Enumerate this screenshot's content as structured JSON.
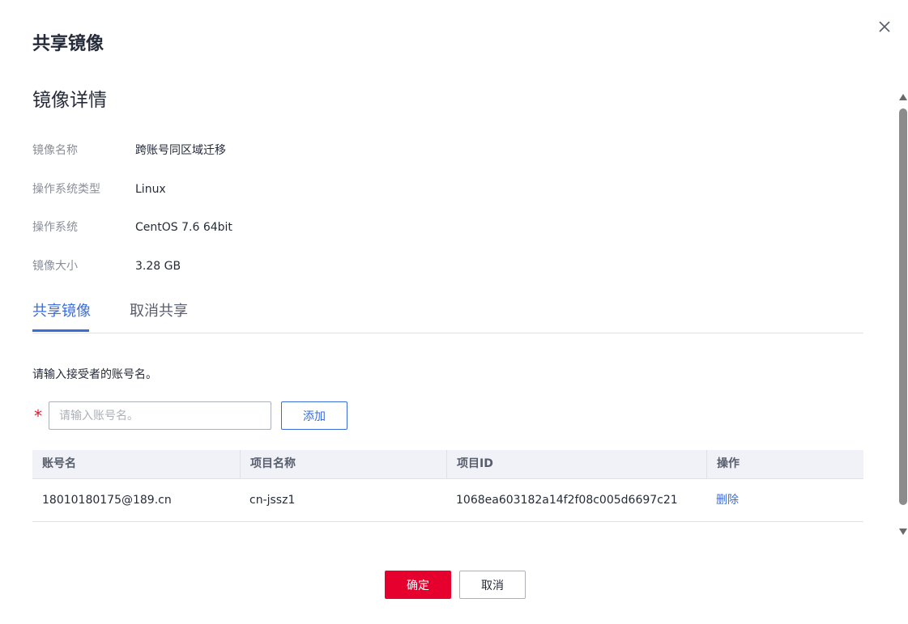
{
  "dialog": {
    "title": "共享镜像",
    "close_icon": "close-icon"
  },
  "details": {
    "section_title": "镜像详情",
    "rows": [
      {
        "label": "镜像名称",
        "value": "跨账号同区域迁移"
      },
      {
        "label": "操作系统类型",
        "value": "Linux"
      },
      {
        "label": "操作系统",
        "value": "CentOS 7.6 64bit"
      },
      {
        "label": "镜像大小",
        "value": "3.28 GB"
      }
    ]
  },
  "tabs": {
    "share": "共享镜像",
    "unshare": "取消共享",
    "active": "share"
  },
  "form": {
    "hint": "请输入接受者的账号名。",
    "required_mark": "*",
    "account_placeholder": "请输入账号名。",
    "account_value": "",
    "add_label": "添加"
  },
  "table": {
    "headers": {
      "account": "账号名",
      "project_name": "项目名称",
      "project_id": "项目ID",
      "action": "操作"
    },
    "rows": [
      {
        "account": "18010180175@189.cn",
        "project_name": "cn-jssz1",
        "project_id": "1068ea603182a14f2f08c005d6697c21",
        "action": "删除"
      }
    ]
  },
  "footer": {
    "confirm_label": "确定",
    "cancel_label": "取消"
  },
  "colors": {
    "accent": "#3b6dd9",
    "primary_button": "#e6002d",
    "required": "#e6142e",
    "label_text": "#8a8e99",
    "table_header_bg": "#f0f2f7"
  }
}
